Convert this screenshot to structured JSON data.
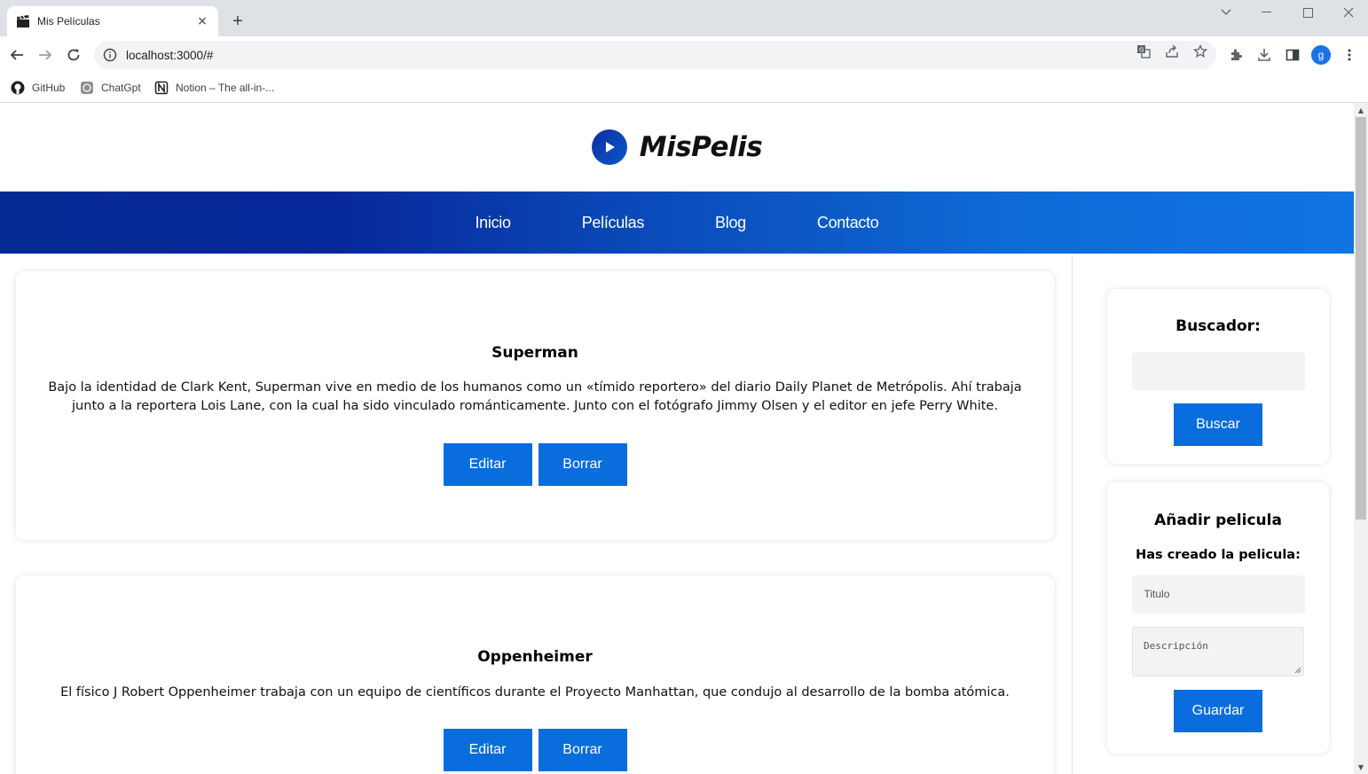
{
  "browser": {
    "tab_title": "Mis Películas",
    "tab_close": "×",
    "new_tab": "+",
    "url": "localhost:3000/#",
    "avatar_letter": "g",
    "bookmarks": [
      {
        "label": "GitHub",
        "icon": "github-icon"
      },
      {
        "label": "ChatGpt",
        "icon": "chatgpt-icon"
      },
      {
        "label": "Notion – The all-in-...",
        "icon": "notion-icon"
      }
    ]
  },
  "site": {
    "logo_text": "MisPelis",
    "accent_color": "#0a6ddd",
    "nav": [
      "Inicio",
      "Películas",
      "Blog",
      "Contacto"
    ]
  },
  "movies": [
    {
      "title": "Superman",
      "description": "Bajo la identidad de Clark Kent, Superman vive en medio de los humanos como un «tímido reportero» del diario Daily Planet de Metrópolis. Ahí trabaja junto a la reportera Lois Lane, con la cual ha sido vinculado románticamente. Junto con el fotógrafo Jimmy Olsen y el editor en jefe Perry White.",
      "edit_label": "Editar",
      "delete_label": "Borrar"
    },
    {
      "title": "Oppenheimer",
      "description": "El físico J Robert Oppenheimer trabaja con un equipo de científicos durante el Proyecto Manhattan, que condujo al desarrollo de la bomba atómica.",
      "edit_label": "Editar",
      "delete_label": "Borrar"
    }
  ],
  "search": {
    "title": "Buscador:",
    "button": "Buscar"
  },
  "add": {
    "title": "Añadir pelicula",
    "subtitle": "Has creado la pelicula:",
    "title_placeholder": "Titulo",
    "desc_placeholder": "Descripción",
    "button": "Guardar"
  }
}
